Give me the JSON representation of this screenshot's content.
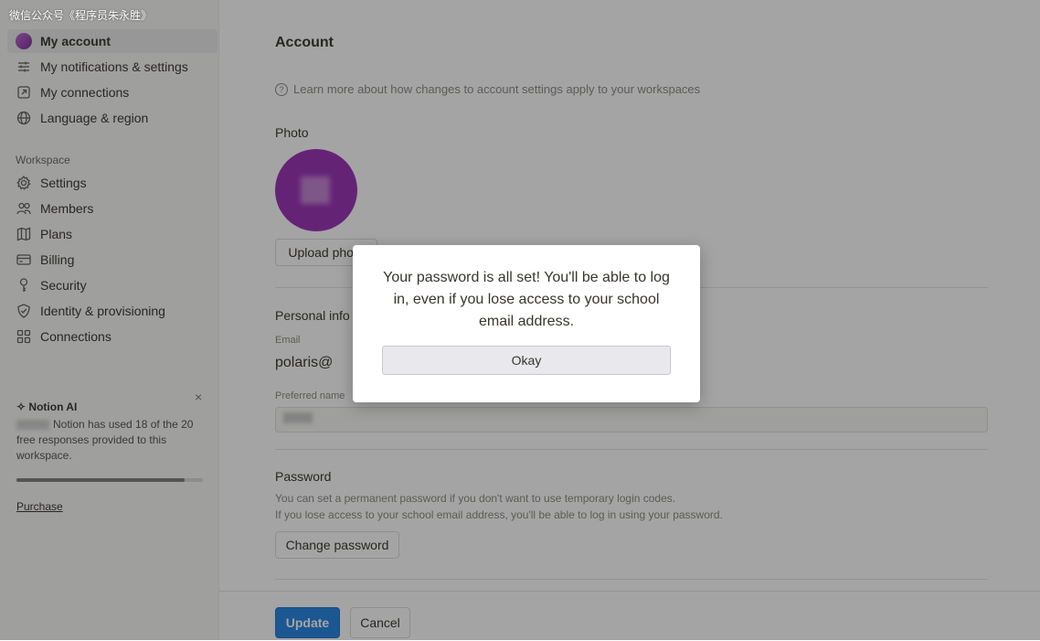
{
  "watermark": "微信公众号《程序员朱永胜》",
  "sidebar": {
    "account_items": [
      {
        "label": "My account",
        "icon": "avatar-icon"
      },
      {
        "label": "My notifications & settings",
        "icon": "sliders-icon"
      },
      {
        "label": "My connections",
        "icon": "external-link-icon"
      },
      {
        "label": "Language & region",
        "icon": "globe-icon"
      }
    ],
    "workspace_label": "Workspace",
    "workspace_items": [
      {
        "label": "Settings",
        "icon": "gear-icon"
      },
      {
        "label": "Members",
        "icon": "people-icon"
      },
      {
        "label": "Plans",
        "icon": "map-icon"
      },
      {
        "label": "Billing",
        "icon": "credit-card-icon"
      },
      {
        "label": "Security",
        "icon": "key-icon"
      },
      {
        "label": "Identity & provisioning",
        "icon": "shield-icon"
      },
      {
        "label": "Connections",
        "icon": "grid-icon"
      }
    ],
    "ai": {
      "title": "Notion AI",
      "text": "Notion has used 18 of the 20 free responses provided to this workspace.",
      "close": "×",
      "usage_fraction": 0.9,
      "link": "Purchase"
    }
  },
  "main": {
    "title": "Account",
    "info": "Learn more about how changes to account settings apply to your workspaces",
    "photo_label": "Photo",
    "upload_button": "Upload photo",
    "personal_info_label": "Personal info",
    "email_label": "Email",
    "email_value": "polaris@",
    "preferred_name_label": "Preferred name",
    "password_label": "Password",
    "password_desc_1": "You can set a permanent password if you don't want to use temporary login codes.",
    "password_desc_2": "If you lose access to your school email address, you'll be able to log in using your password.",
    "change_password_button": "Change password",
    "update_button": "Update",
    "cancel_button": "Cancel"
  },
  "modal": {
    "message": "Your password is all set! You'll be able to log in, even if you lose access to your school email address.",
    "ok_button": "Okay"
  },
  "colors": {
    "accent": "#2383e2",
    "avatar": "#9a2fb5",
    "sidebar_bg": "#f7f7f5"
  }
}
